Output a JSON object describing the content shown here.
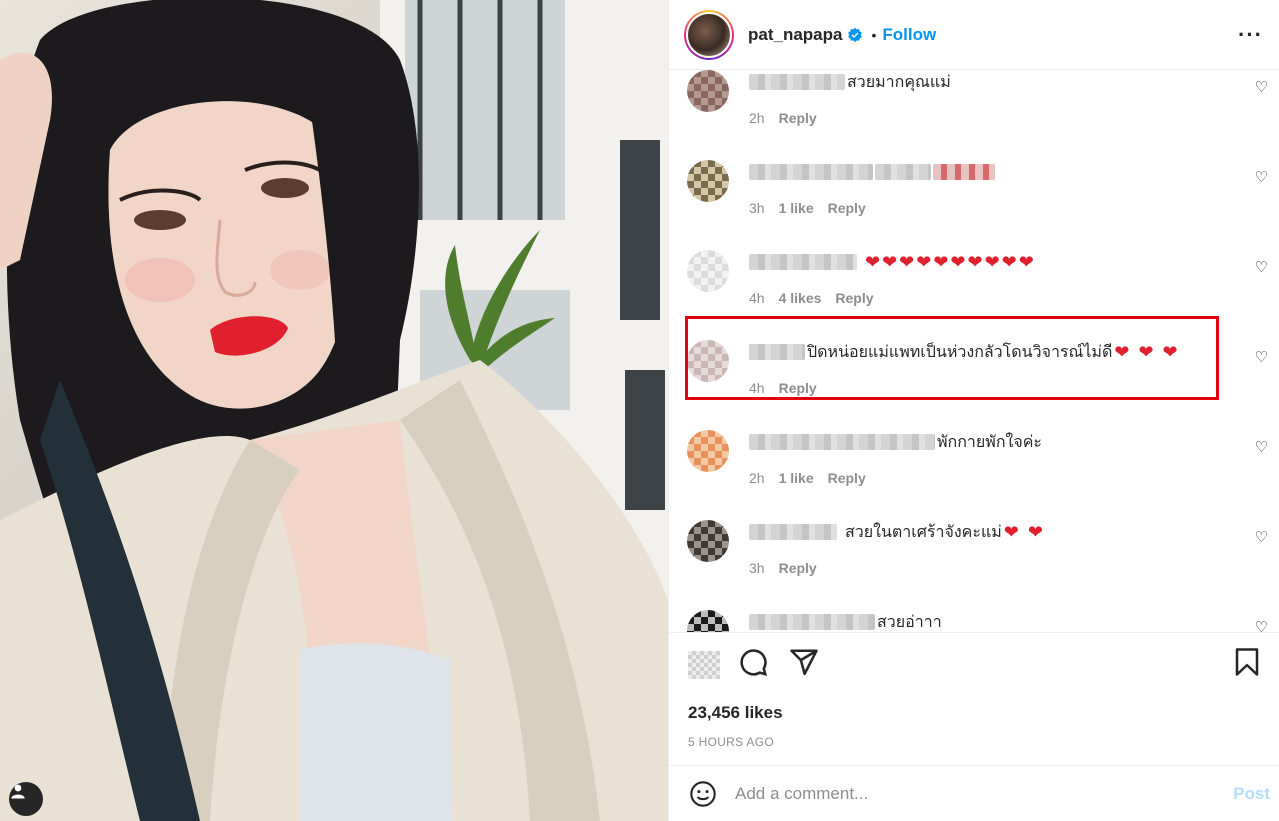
{
  "post": {
    "username": "pat_napapa",
    "separator": "•",
    "follow_label": "Follow",
    "more_icon": "more-horizontal-icon"
  },
  "comments": [
    {
      "text": "สวยมากคุณแม่",
      "hearts": "",
      "time": "2h",
      "likes": "",
      "reply": "Reply"
    },
    {
      "text": "",
      "hearts": "",
      "time": "3h",
      "likes": "1 like",
      "reply": "Reply"
    },
    {
      "text": "",
      "hearts": "❤❤❤❤❤❤❤❤❤❤",
      "time": "4h",
      "likes": "4 likes",
      "reply": "Reply"
    },
    {
      "text": "ปิดหน่อยแม่แพทเป็นห่วงกลัวโดนวิจารณ์ไม่ดี",
      "hearts": "❤ ❤ ❤",
      "time": "4h",
      "likes": "",
      "reply": "Reply"
    },
    {
      "text": "พักกายพักใจค่ะ",
      "hearts": "",
      "time": "2h",
      "likes": "1 like",
      "reply": "Reply"
    },
    {
      "text": "สวยในตาเศร้าจังคะแม่",
      "hearts": "❤ ❤",
      "time": "3h",
      "likes": "",
      "reply": "Reply"
    },
    {
      "text": "สวยอ่าาา",
      "hearts": "",
      "time": "",
      "likes": "",
      "reply": ""
    }
  ],
  "footer": {
    "likes_count": "23,456 likes",
    "time_ago": "5 HOURS AGO",
    "comment_placeholder": "Add a comment...",
    "post_label": "Post"
  },
  "colors": {
    "follow": "#0095f6",
    "highlight_box": "#e0000f",
    "heart": "#e0202e",
    "post_disabled": "#b2dffc"
  }
}
